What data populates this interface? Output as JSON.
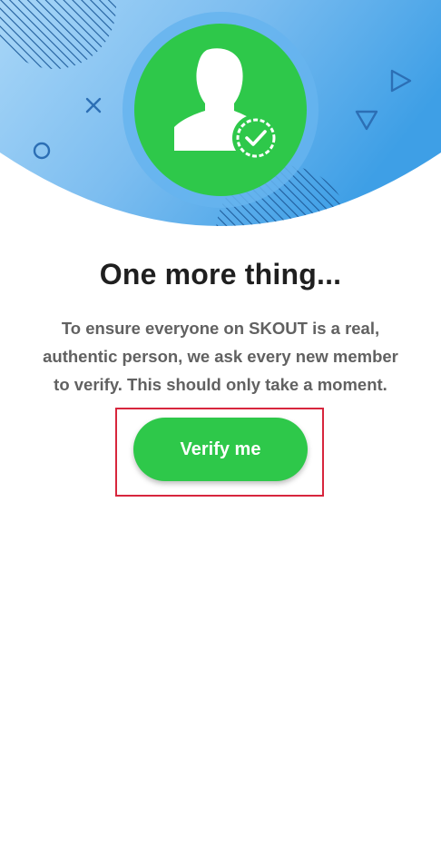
{
  "verify_screen": {
    "title": "One more thing...",
    "description": "To ensure everyone on SKOUT is a real, authentic person, we ask every new member to verify. This should only take a moment.",
    "verify_button_label": "Verify me"
  },
  "colors": {
    "header_blue_light": "#9fd2f6",
    "header_blue_dark": "#3e9fe6",
    "accent_green": "#2ec84a",
    "avatar_halo": "#66b4ee",
    "highlight_red": "#d7263d",
    "title_text": "#1f1f1f",
    "body_text": "#616161"
  },
  "icons": {
    "avatar": "person-verified-icon",
    "badge": "check-circle-icon",
    "decor": [
      "x-icon",
      "circle-outline-icon",
      "triangle-right-icon",
      "triangle-down-icon"
    ]
  }
}
